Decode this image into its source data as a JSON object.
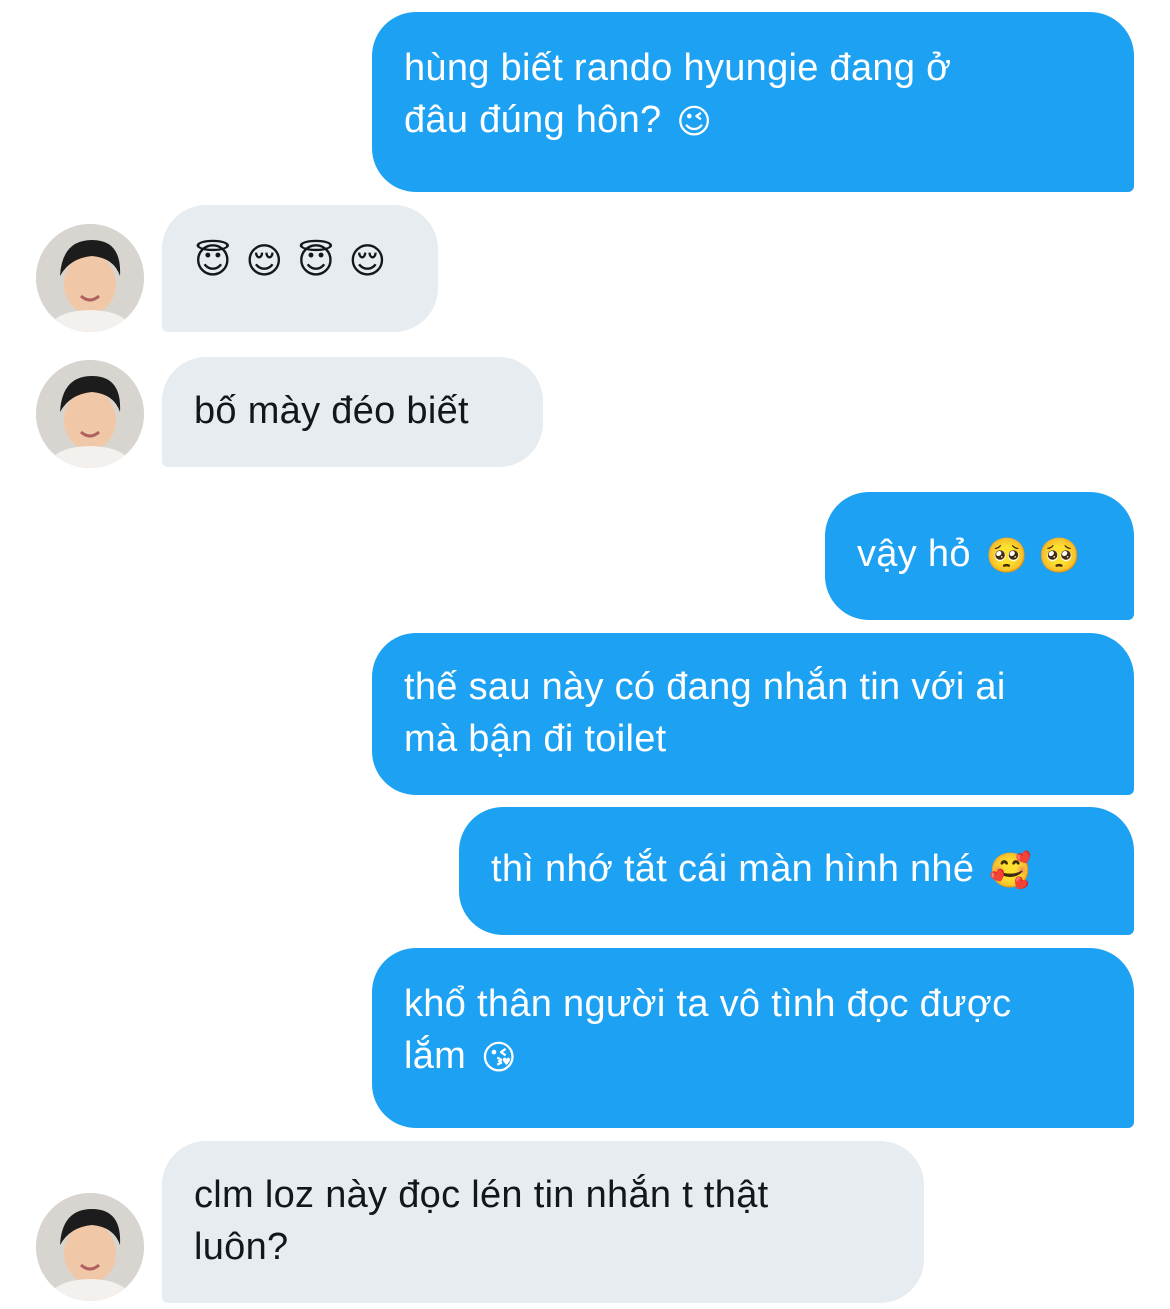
{
  "conversation": {
    "messages": [
      {
        "side": "sent",
        "text": "hùng biết rando hyungie đang ở\nđâu đúng hôn?",
        "emoji": "😉"
      },
      {
        "side": "received",
        "text": "",
        "emoji": "😇 😌 😇 😌"
      },
      {
        "side": "received",
        "text": "bố mày đéo biết",
        "emoji": ""
      },
      {
        "side": "sent",
        "text": "vậy hỏ",
        "emoji": "🥺 🥺"
      },
      {
        "side": "sent",
        "text": "thế sau này có đang nhắn tin với ai\nmà bận đi toilet",
        "emoji": ""
      },
      {
        "side": "sent",
        "text": "thì nhớ tắt cái màn hình nhé",
        "emoji": "🥰"
      },
      {
        "side": "sent",
        "text": "khổ thân người ta vô tình đọc được\nlắm",
        "emoji": "😘"
      },
      {
        "side": "received",
        "text": "clm loz này đọc lén tin nhắn t thật\nluôn?",
        "emoji": ""
      }
    ]
  },
  "colors": {
    "sent_bubble": "#1da1f2",
    "received_bubble": "#e6ecf0",
    "sent_text": "#ffffff",
    "received_text": "#14171a"
  }
}
